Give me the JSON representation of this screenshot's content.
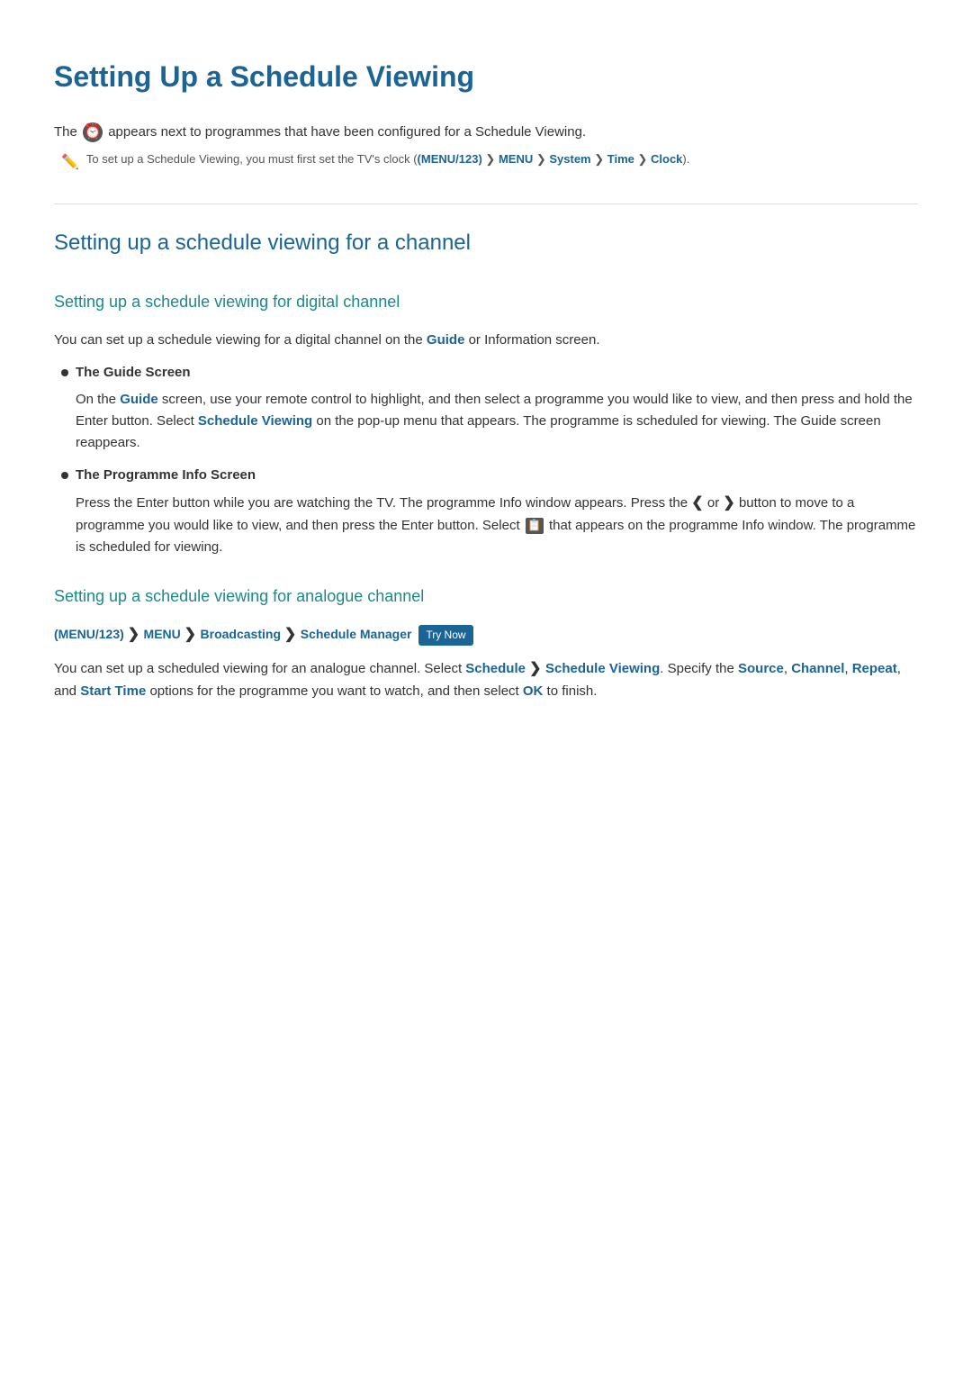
{
  "page": {
    "main_title": "Setting Up a Schedule Viewing",
    "section1_title": "Setting up a schedule viewing for a channel",
    "intro_text_before_icon": "The",
    "intro_text_after_icon": "appears next to programmes that have been configured for a Schedule Viewing.",
    "note_text": "To set up a Schedule Viewing, you must first set the TV's clock (",
    "note_menu123": "(MENU/123)",
    "note_arrow1": "❯",
    "note_menu": "MENU",
    "note_arrow2": "❯",
    "note_system": "System",
    "note_arrow3": "❯",
    "note_time": "Time",
    "note_arrow4": "❯",
    "note_clock": "Clock",
    "note_end": ").",
    "digital_subtitle": "Setting up a schedule viewing for digital channel",
    "digital_intro": "You can set up a schedule viewing for a digital channel on the",
    "digital_guide_link": "Guide",
    "digital_or": "or Information screen.",
    "bullet1_title": "The Guide Screen",
    "bullet1_body_1": "On the",
    "bullet1_guide_link": "Guide",
    "bullet1_body_2": "screen, use your remote control to highlight, and then select a programme you would like to view, and then press and hold the Enter button. Select",
    "bullet1_schedule_link": "Schedule Viewing",
    "bullet1_body_3": "on the pop-up menu that appears. The programme is scheduled for viewing. The Guide screen reappears.",
    "bullet2_title": "The Programme Info Screen",
    "bullet2_body_1": "Press the Enter button while you are watching the TV. The programme Info window appears. Press the",
    "bullet2_chevron_left": "❮",
    "bullet2_or": "or",
    "bullet2_chevron_right": "❯",
    "bullet2_body_2": "button to move to a programme you would like to view, and then press the Enter button. Select",
    "bullet2_body_3": "that appears on the programme Info window. The programme is scheduled for viewing.",
    "analogue_subtitle": "Setting up a schedule viewing for analogue channel",
    "breadcrumb_menu123": "(MENU/123)",
    "breadcrumb_arrow1": "❯",
    "breadcrumb_menu": "MENU",
    "breadcrumb_arrow2": "❯",
    "breadcrumb_broadcasting": "Broadcasting",
    "breadcrumb_arrow3": "❯",
    "breadcrumb_schedule_manager": "Schedule Manager",
    "try_now_label": "Try Now",
    "analogue_body_1": "You can set up a scheduled viewing for an analogue channel. Select",
    "analogue_schedule_link": "Schedule",
    "analogue_arrow": "❯",
    "analogue_schedule_viewing_link": "Schedule Viewing",
    "analogue_body_2": ". Specify the",
    "analogue_source_link": "Source",
    "analogue_comma1": ",",
    "analogue_channel_link": "Channel",
    "analogue_comma2": ",",
    "analogue_repeat_link": "Repeat",
    "analogue_comma3": ",",
    "analogue_and": "and",
    "analogue_start_time_link": "Start Time",
    "analogue_body_3": "options for the programme you want to watch, and then select",
    "analogue_ok_link": "OK",
    "analogue_body_4": "to finish."
  }
}
